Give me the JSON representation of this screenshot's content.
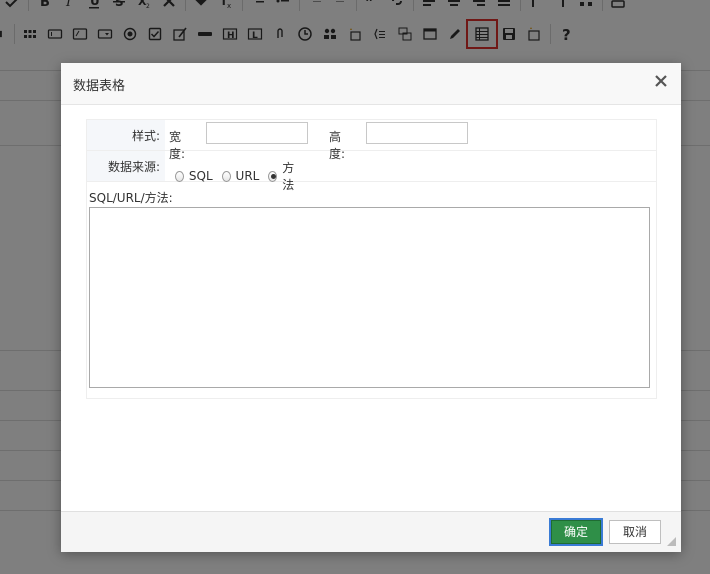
{
  "dialog": {
    "title": "数据表格",
    "style_label": "样式:",
    "width_label": "宽度:",
    "height_label": "高度:",
    "width_value": "",
    "height_value": "",
    "source_label": "数据来源:",
    "source_options": [
      "SQL",
      "URL",
      "方法"
    ],
    "source_selected": "方法",
    "textarea_label": "SQL/URL/方法:",
    "textarea_value": "",
    "ok_label": "确定",
    "cancel_label": "取消"
  },
  "colors": {
    "ok_button": "#2f8f48",
    "highlight": "#e0302c",
    "overlay": "rgba(0,0,0,0.5)"
  },
  "toolbar": {
    "active_icon": "data-table-icon"
  }
}
